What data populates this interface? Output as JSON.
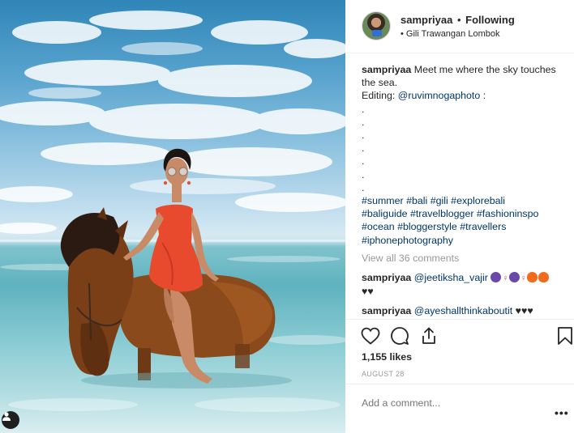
{
  "post": {
    "username": "sampriyaa",
    "separator": "•",
    "follow_status": "Following",
    "location": "• Gili Trawangan Lombok"
  },
  "caption": {
    "username": "sampriyaa",
    "text": "Meet me where the sky touches the sea.",
    "editing_label": "Editing:",
    "editing_mention": "@ruvimnogaphoto",
    "colon": ":",
    "dots": [
      ".",
      ".",
      ".",
      ".",
      ".",
      ".",
      "."
    ],
    "hashtag_lines": [
      "#summer #bali #gili #explorebali",
      "#baliguide #travelblogger #fashioninspo",
      "#ocean #bloggerstyle #travellers",
      "#iphonephotography"
    ]
  },
  "view_all_comments": "View all 36 comments",
  "comments": [
    {
      "username": "sampriyaa",
      "mention": "@jeetiksha_vajir",
      "emoji": [
        "purple-face",
        "female-sign",
        "purple-face",
        "female-sign",
        "fire",
        "fire"
      ],
      "hearts": "♥♥"
    },
    {
      "username": "sampriyaa",
      "mention": "@ayeshallthinkaboutit",
      "hearts": "♥♥♥"
    }
  ],
  "likes": "1,155 likes",
  "date": "AUGUST 28",
  "add_comment_placeholder": "Add a comment...",
  "more_label": "•••",
  "icons": {
    "like": "heart-icon",
    "comment": "speech-bubble-icon",
    "share": "share-icon",
    "save": "bookmark-icon",
    "tagged": "user-tag-icon"
  },
  "colors": {
    "link": "#003569",
    "muted": "#999999",
    "text": "#262626"
  }
}
